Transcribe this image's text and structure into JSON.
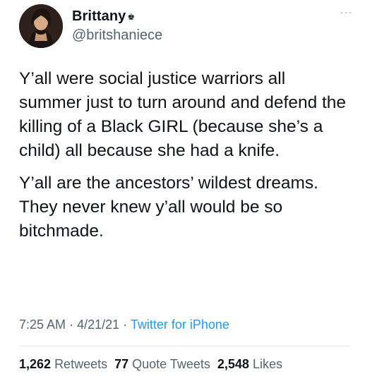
{
  "user": {
    "display_name": "Brittany",
    "badge": "♚",
    "handle": "@britshaniece"
  },
  "more_icon": "···",
  "tweet": {
    "paragraph_1": "Y’all were social justice warriors all summer just to turn around and defend the killing of a Black GIRL (because she’s a child) all because she had a knife.",
    "paragraph_2": "Y’all are the ancestors’ wildest dreams. They never knew y’all would be so bitchmade."
  },
  "meta": {
    "time": "7:25 AM",
    "separator": "·",
    "date": "4/21/21",
    "source": "Twitter for iPhone"
  },
  "stats": {
    "retweets_count": "1,262",
    "retweets_label": "Retweets",
    "quotes_count": "77",
    "quotes_label": "Quote Tweets",
    "likes_count": "2,548",
    "likes_label": "Likes"
  },
  "colors": {
    "text": "#0f1419",
    "secondary": "#536471",
    "link": "#1d9bf0",
    "divider": "#e6ecf0"
  }
}
